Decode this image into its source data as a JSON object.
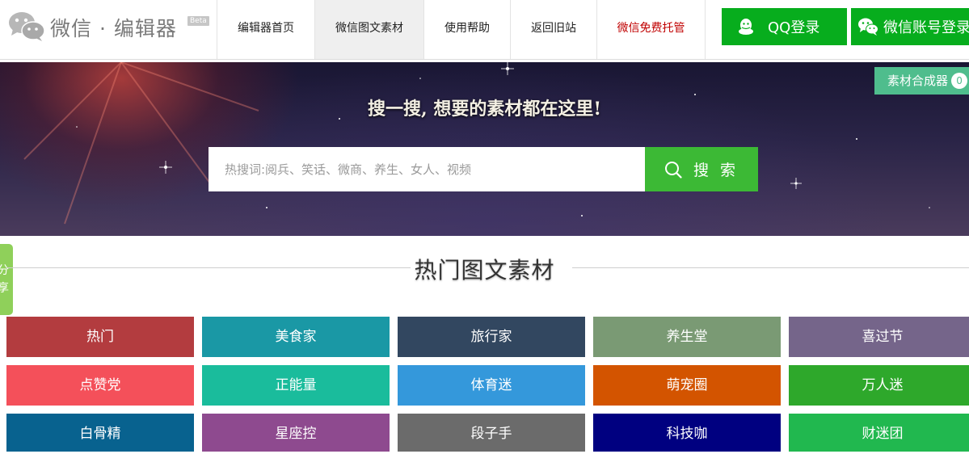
{
  "header": {
    "logo_text": "微信 · 编辑器",
    "beta": "Beta",
    "nav": [
      {
        "label": "编辑器首页"
      },
      {
        "label": "微信图文素材"
      },
      {
        "label": "使用帮助"
      },
      {
        "label": "返回旧站"
      },
      {
        "label": "微信免费托管"
      }
    ],
    "qq_login": "QQ登录",
    "wechat_login": "微信账号登录"
  },
  "banner": {
    "title": "搜一搜, 想要的素材都在这里!",
    "search_placeholder": "热搜词:阅兵、笑话、微商、养生、女人、视频",
    "search_button": "搜 索",
    "composer_label": "素材合成器",
    "composer_count": "0"
  },
  "share_tab": "分享",
  "section_title": "热门图文素材",
  "categories": [
    {
      "label": "热门",
      "color": "#b33c3f"
    },
    {
      "label": "美食家",
      "color": "#1a98a5"
    },
    {
      "label": "旅行家",
      "color": "#324760"
    },
    {
      "label": "养生堂",
      "color": "#7a9a74"
    },
    {
      "label": "喜过节",
      "color": "#75658a"
    },
    {
      "label": "点赞党",
      "color": "#f4505a"
    },
    {
      "label": "正能量",
      "color": "#1abc9c"
    },
    {
      "label": "体育迷",
      "color": "#3498db"
    },
    {
      "label": "萌宠圈",
      "color": "#d35400"
    },
    {
      "label": "万人迷",
      "color": "#2ea82b"
    },
    {
      "label": "白骨精",
      "color": "#08628f"
    },
    {
      "label": "星座控",
      "color": "#8e4a8f"
    },
    {
      "label": "段子手",
      "color": "#6b6b6b"
    },
    {
      "label": "科技咖",
      "color": "#000080"
    },
    {
      "label": "财迷团",
      "color": "#21b84f"
    }
  ],
  "colors": {
    "accent_green": "#07ad1d",
    "search_green": "#3cb935",
    "composer_green": "#4fbd8d",
    "nav_red": "#c00000"
  }
}
